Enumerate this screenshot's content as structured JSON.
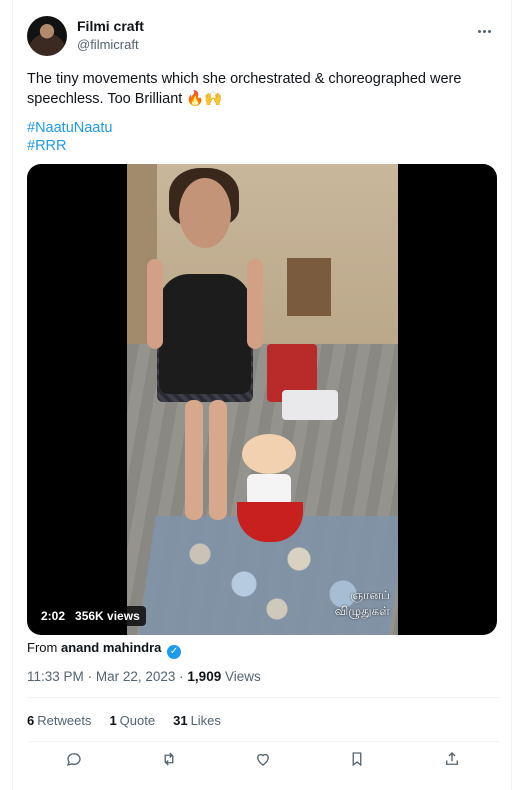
{
  "author": {
    "name": "Filmi craft",
    "handle": "@filmicraft"
  },
  "post": {
    "text": "The tiny movements which she orchestrated & choreographed were speechless. Too Brilliant 🔥🙌",
    "hashtags": [
      "#NaatuNaatu",
      "#RRR"
    ]
  },
  "media": {
    "duration": "2:02",
    "views": "356K views",
    "overlay_text_line1": "ஞானப்",
    "overlay_text_line2": "விழுதுகள்"
  },
  "source": {
    "prefix": "From",
    "account": "anand mahindra"
  },
  "meta": {
    "time": "11:33 PM",
    "separator": "·",
    "date": "Mar 22, 2023",
    "views_count": "1,909",
    "views_label": "Views"
  },
  "stats": [
    {
      "count": "6",
      "label": "Retweets"
    },
    {
      "count": "1",
      "label": "Quote"
    },
    {
      "count": "31",
      "label": "Likes"
    }
  ],
  "actions": [
    "reply-icon",
    "retweet-icon",
    "like-icon",
    "bookmark-icon",
    "share-icon"
  ],
  "colors": {
    "accent": "#1d9bf0",
    "secondary": "#536471",
    "text": "#0f1419"
  }
}
